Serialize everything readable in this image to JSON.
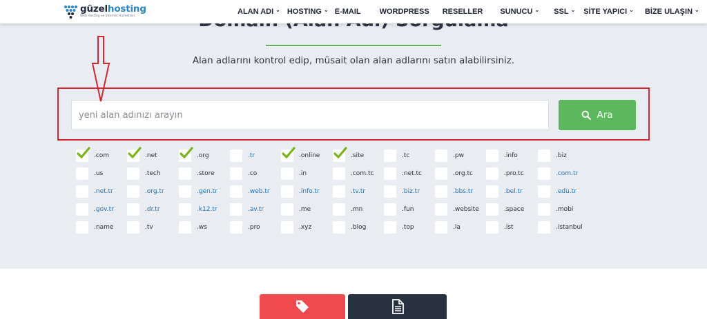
{
  "header": {
    "logo": {
      "brand_first": "güzel",
      "brand_second": "hosting",
      "tagline": "Web Hosting ve İnternet Hizmetleri"
    },
    "nav": [
      {
        "label": "ALAN ADI",
        "dropdown": true
      },
      {
        "label": "HOSTING",
        "dropdown": true
      },
      {
        "label": "E-MAIL",
        "dropdown": false
      },
      {
        "label": "WORDPRESS",
        "dropdown": false
      },
      {
        "label": "RESELLER",
        "dropdown": false
      },
      {
        "label": "SUNUCU",
        "dropdown": true
      },
      {
        "label": "SSL",
        "dropdown": true
      },
      {
        "label": "SİTE YAPICI",
        "dropdown": true
      },
      {
        "label": "BİZE ULAŞIN",
        "dropdown": true
      }
    ]
  },
  "hero": {
    "title": "Domain (Alan Adı) Sorgulama",
    "subtitle": "Alan adlarını kontrol edip, müsait olan alan adlarını satın alabilirsiniz.",
    "search": {
      "placeholder": "yeni alan adınızı arayın",
      "value": "",
      "button_label": "Ara"
    }
  },
  "tlds": [
    [
      {
        "name": ".com",
        "checked": true,
        "blue": false
      },
      {
        "name": ".net",
        "checked": true,
        "blue": false
      },
      {
        "name": ".org",
        "checked": true,
        "blue": false
      },
      {
        "name": ".tr",
        "checked": false,
        "blue": true
      },
      {
        "name": ".online",
        "checked": true,
        "blue": false
      },
      {
        "name": ".site",
        "checked": true,
        "blue": false
      },
      {
        "name": ".tc",
        "checked": false,
        "blue": false
      },
      {
        "name": ".pw",
        "checked": false,
        "blue": false
      },
      {
        "name": ".info",
        "checked": false,
        "blue": false
      },
      {
        "name": ".biz",
        "checked": false,
        "blue": false
      }
    ],
    [
      {
        "name": ".us",
        "checked": false,
        "blue": false
      },
      {
        "name": ".tech",
        "checked": false,
        "blue": false
      },
      {
        "name": ".store",
        "checked": false,
        "blue": false
      },
      {
        "name": ".co",
        "checked": false,
        "blue": false
      },
      {
        "name": ".in",
        "checked": false,
        "blue": false
      },
      {
        "name": ".com.tc",
        "checked": false,
        "blue": false
      },
      {
        "name": ".net.tc",
        "checked": false,
        "blue": false
      },
      {
        "name": ".org.tc",
        "checked": false,
        "blue": false
      },
      {
        "name": ".pro.tc",
        "checked": false,
        "blue": false
      },
      {
        "name": ".com.tr",
        "checked": false,
        "blue": true
      }
    ],
    [
      {
        "name": ".net.tr",
        "checked": false,
        "blue": true
      },
      {
        "name": ".org.tr",
        "checked": false,
        "blue": true
      },
      {
        "name": ".gen.tr",
        "checked": false,
        "blue": true
      },
      {
        "name": ".web.tr",
        "checked": false,
        "blue": true
      },
      {
        "name": ".info.tr",
        "checked": false,
        "blue": true
      },
      {
        "name": ".tv.tr",
        "checked": false,
        "blue": true
      },
      {
        "name": ".biz.tr",
        "checked": false,
        "blue": true
      },
      {
        "name": ".bbs.tr",
        "checked": false,
        "blue": true
      },
      {
        "name": ".bel.tr",
        "checked": false,
        "blue": true
      },
      {
        "name": ".edu.tr",
        "checked": false,
        "blue": true
      }
    ],
    [
      {
        "name": ".gov.tr",
        "checked": false,
        "blue": true
      },
      {
        "name": ".dr.tr",
        "checked": false,
        "blue": true
      },
      {
        "name": ".k12.tr",
        "checked": false,
        "blue": true
      },
      {
        "name": ".av.tr",
        "checked": false,
        "blue": true
      },
      {
        "name": ".me",
        "checked": false,
        "blue": false
      },
      {
        "name": ".mn",
        "checked": false,
        "blue": false
      },
      {
        "name": ".fun",
        "checked": false,
        "blue": false
      },
      {
        "name": ".website",
        "checked": false,
        "blue": false
      },
      {
        "name": ".space",
        "checked": false,
        "blue": false
      },
      {
        "name": ".mobi",
        "checked": false,
        "blue": false
      }
    ],
    [
      {
        "name": ".name",
        "checked": false,
        "blue": false
      },
      {
        "name": ".tv",
        "checked": false,
        "blue": false
      },
      {
        "name": ".ws",
        "checked": false,
        "blue": false
      },
      {
        "name": ".pro",
        "checked": false,
        "blue": false
      },
      {
        "name": ".xyz",
        "checked": false,
        "blue": false
      },
      {
        "name": ".blog",
        "checked": false,
        "blue": false
      },
      {
        "name": ".top",
        "checked": false,
        "blue": false
      },
      {
        "name": ".la",
        "checked": false,
        "blue": false
      },
      {
        "name": ".ist",
        "checked": false,
        "blue": false
      },
      {
        "name": ".istanbul",
        "checked": false,
        "blue": false
      }
    ]
  ],
  "bottom_tabs": [
    {
      "icon": "tag-icon",
      "color": "#ef4b4f"
    },
    {
      "icon": "document-icon",
      "color": "#283142"
    }
  ],
  "colors": {
    "accent_green": "#5cb85c",
    "annotation_red": "#d9232e",
    "link_blue": "#1c72b8",
    "hero_bg": "#e9edf1"
  }
}
